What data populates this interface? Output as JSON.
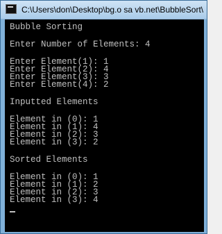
{
  "window": {
    "title": "C:\\Users\\don\\Desktop\\bg.o sa vb.net\\BubbleSort\\"
  },
  "console": {
    "lines": [
      "Bubble Sorting",
      "Enter Number of Elements: 4",
      "Enter Element(1): 1",
      "Enter Element(2): 4",
      "Enter Element(3): 3",
      "Enter Element(4): 2",
      "Inputted Elements",
      "Element in (0): 1",
      "Element in (1): 4",
      "Element in (2): 3",
      "Element in (3): 2",
      "Sorted Elements",
      "Element in (0): 1",
      "Element in (1): 2",
      "Element in (2): 3",
      "Element in (3): 4"
    ]
  }
}
